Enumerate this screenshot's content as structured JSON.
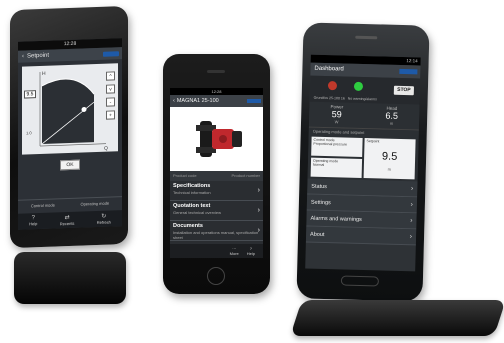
{
  "phone1": {
    "status_time": "12:28",
    "nav_title": "Setpoint",
    "chart": {
      "value_box": "9.5",
      "axis_top": "H",
      "axis_bottom": "Q",
      "left_tick": "1.0"
    },
    "side_buttons": [
      "^",
      "v",
      "-",
      "+"
    ],
    "ok_label": "OK",
    "modes": [
      "Control mode",
      "Operating mode"
    ],
    "toolbar": [
      {
        "icon": "?",
        "label": "Help"
      },
      {
        "icon": "⇄",
        "label": "Recents"
      },
      {
        "icon": "↻",
        "label": "Refresh"
      }
    ]
  },
  "phone2": {
    "status_time": "12:28",
    "nav_title": "MAGNA1 25-100",
    "caption_left": "Product code",
    "caption_right": "Product number",
    "menu": [
      {
        "title": "Specifications",
        "subtitle": "Technical information"
      },
      {
        "title": "Quotation text",
        "subtitle": "General technical overview"
      },
      {
        "title": "Documents",
        "subtitle": "Installation and operations manual, specification sheet"
      }
    ],
    "bottombar": [
      {
        "icon": "⋯",
        "label": "More"
      },
      {
        "icon": "?",
        "label": "Help"
      }
    ]
  },
  "phone3": {
    "status_time": "12:14",
    "nav_title": "Dashboard",
    "pump_label": "Grundfos 25-100 16",
    "alarm_label": "No warning/alarms",
    "stop_label": "STOP",
    "metrics": [
      {
        "label": "Power",
        "value": "59",
        "unit": "W"
      },
      {
        "label": "Head",
        "value": "6.5",
        "unit": "m"
      }
    ],
    "section_label": "Operating mode and setpoint",
    "tiles": {
      "control_mode_title": "Control mode",
      "control_mode_value": "Proportional pressure",
      "operating_mode_title": "Operating mode",
      "operating_mode_value": "Normal",
      "setpoint_title": "Setpoint",
      "setpoint_value": "9.5",
      "setpoint_unit": "m"
    },
    "list": [
      "Status",
      "Settings",
      "Alarms and warnings",
      "About"
    ]
  },
  "colors": {
    "brand_blue": "#1e5aa8",
    "screen_dark": "#2e3236",
    "stop_red": "#c0392b",
    "ok_green": "#2ecc40"
  }
}
